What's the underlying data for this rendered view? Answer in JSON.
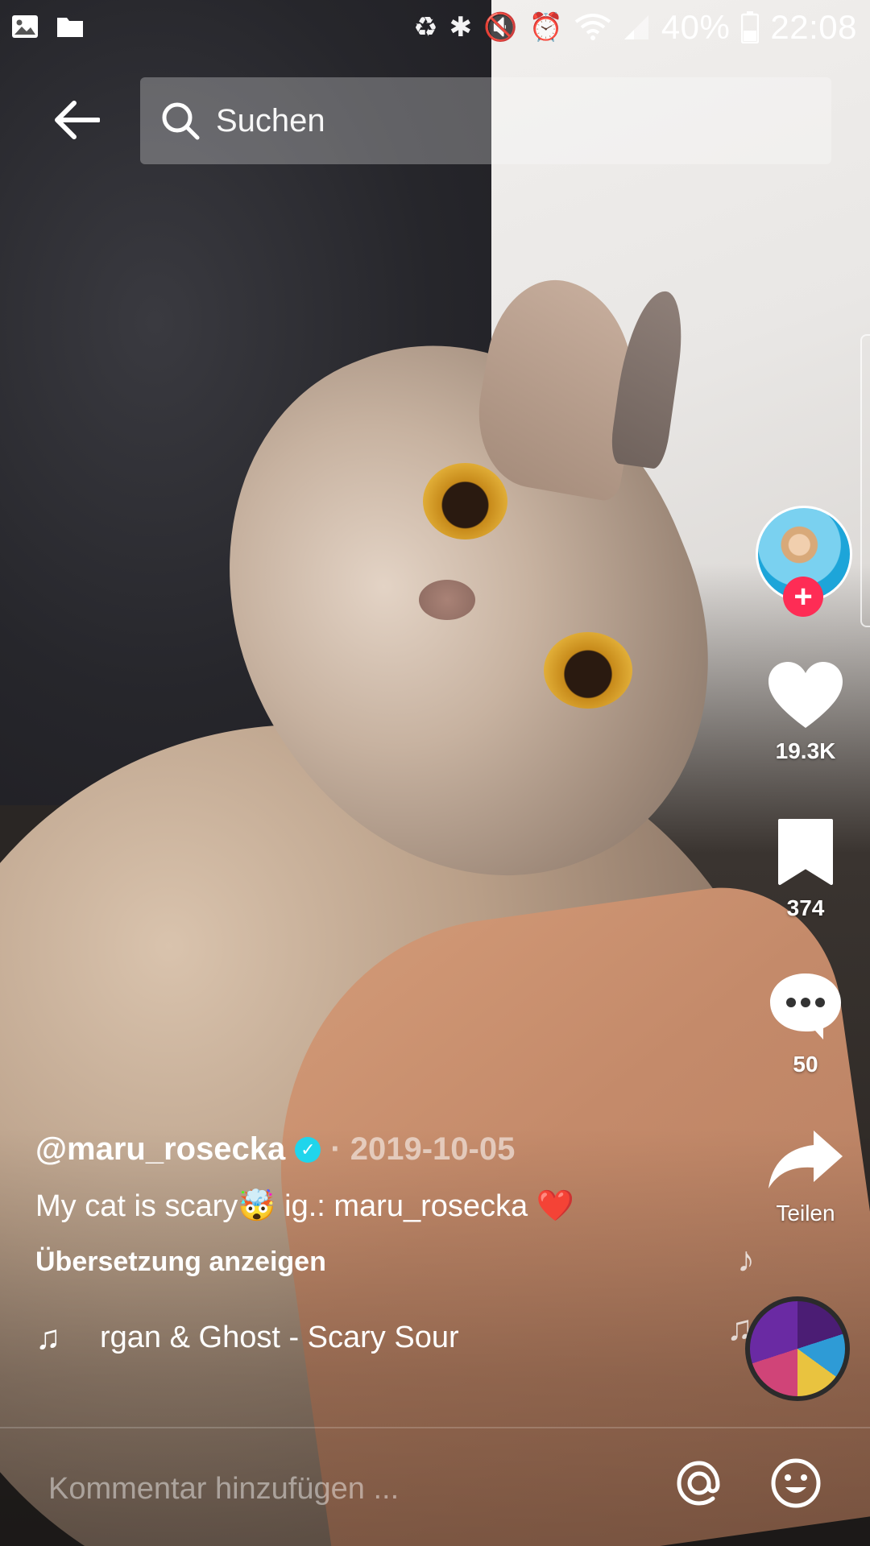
{
  "status_bar": {
    "battery": "40%",
    "time": "22:08",
    "icons": [
      "gallery-icon",
      "folder-icon",
      "battery-saver-icon",
      "bluetooth-icon",
      "mute-icon",
      "alarm-icon",
      "wifi-icon",
      "signal-icon",
      "battery-icon"
    ]
  },
  "search": {
    "placeholder": "Suchen"
  },
  "video": {
    "author": "@maru_rosecka",
    "verified": true,
    "date_separator": " · ",
    "date": "2019-10-05",
    "description": "My cat is scary🤯 ig.: maru_rosecka ❤️",
    "translate_label": "Übersetzung anzeigen",
    "music": "rgan & Ghost - Scary Sour"
  },
  "actions": {
    "likes": "19.3K",
    "saves": "374",
    "comments": "50",
    "share_label": "Teilen"
  },
  "comment_bar": {
    "placeholder": "Kommentar hinzufügen ..."
  },
  "colors": {
    "follow_plus": "#fe2c55",
    "verified": "#20d5ec"
  }
}
